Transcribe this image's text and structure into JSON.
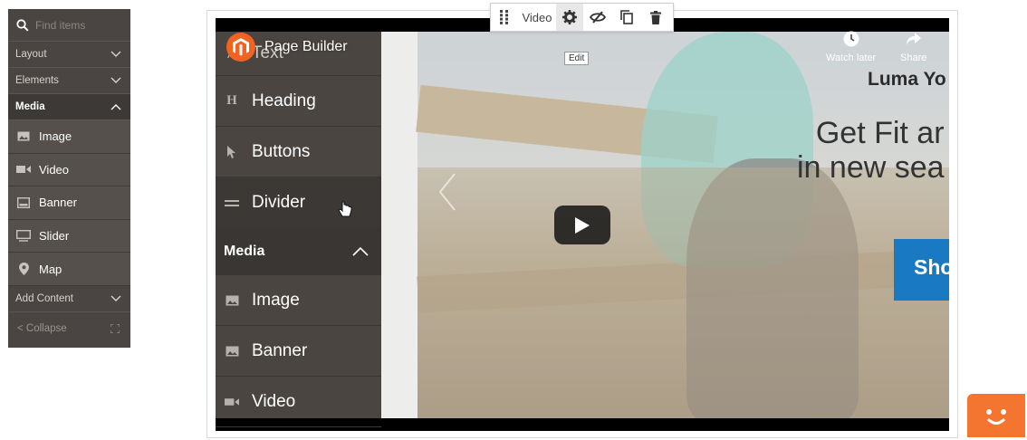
{
  "panel": {
    "search_placeholder": "Find items",
    "groups": {
      "layout": "Layout",
      "elements": "Elements",
      "media": "Media",
      "add_content": "Add Content"
    },
    "media_items": [
      "Image",
      "Video",
      "Banner",
      "Slider",
      "Map"
    ],
    "collapse": "Collapse"
  },
  "toolbar": {
    "label": "Video",
    "tooltip": "Edit"
  },
  "video": {
    "title": "Page Builder",
    "watch_later": "Watch later",
    "share": "Share",
    "inner_rows": [
      "Text",
      "Heading",
      "Buttons",
      "Divider"
    ],
    "inner_media_header": "Media",
    "inner_media_rows": [
      "Image",
      "Banner",
      "Video"
    ],
    "hero_brand": "Luma Yo",
    "hero_line1": "Get Fit ar",
    "hero_line2": "in new sea",
    "shop_button": "Sho"
  },
  "colors": {
    "panel_bg": "#4a4542",
    "accent_orange": "#f26322",
    "shop_blue": "#1979c3",
    "help_orange": "#f4752f"
  }
}
